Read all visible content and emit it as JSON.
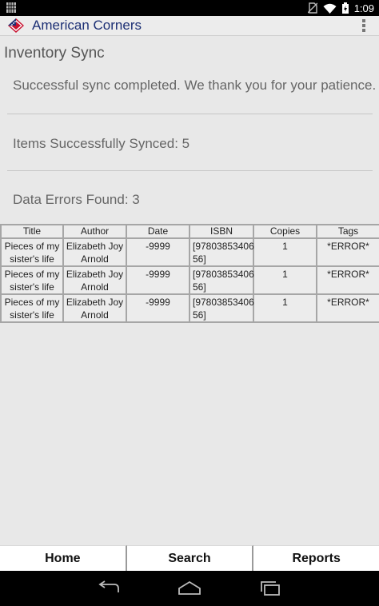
{
  "status_bar": {
    "time": "1:09"
  },
  "action_bar": {
    "title": "American Corners"
  },
  "page": {
    "heading": "Inventory Sync",
    "success_message": "Successful sync completed. We thank you for your patience.",
    "items_synced": "Items Successfully Synced: 5",
    "data_errors": "Data Errors Found: 3"
  },
  "table": {
    "headers": [
      "Title",
      "Author",
      "Date",
      "ISBN",
      "Copies",
      "Tags"
    ],
    "rows": [
      {
        "title": "Pieces of my sister's life",
        "author": "Elizabeth Joy Arnold",
        "date": "-9999",
        "isbn": "[97803853406 56]",
        "copies": "1",
        "tags": "*ERROR*"
      },
      {
        "title": "Pieces of my sister's life",
        "author": "Elizabeth Joy Arnold",
        "date": "-9999",
        "isbn": "[97803853406 56]",
        "copies": "1",
        "tags": "*ERROR*"
      },
      {
        "title": "Pieces of my sister's life",
        "author": "Elizabeth Joy Arnold",
        "date": "-9999",
        "isbn": "[97803853406 56]",
        "copies": "1",
        "tags": "*ERROR*"
      }
    ]
  },
  "bottom_nav": {
    "home": "Home",
    "search": "Search",
    "reports": "Reports"
  },
  "colors": {
    "title_blue": "#1c2f74",
    "error_red": "#e23b3b"
  }
}
